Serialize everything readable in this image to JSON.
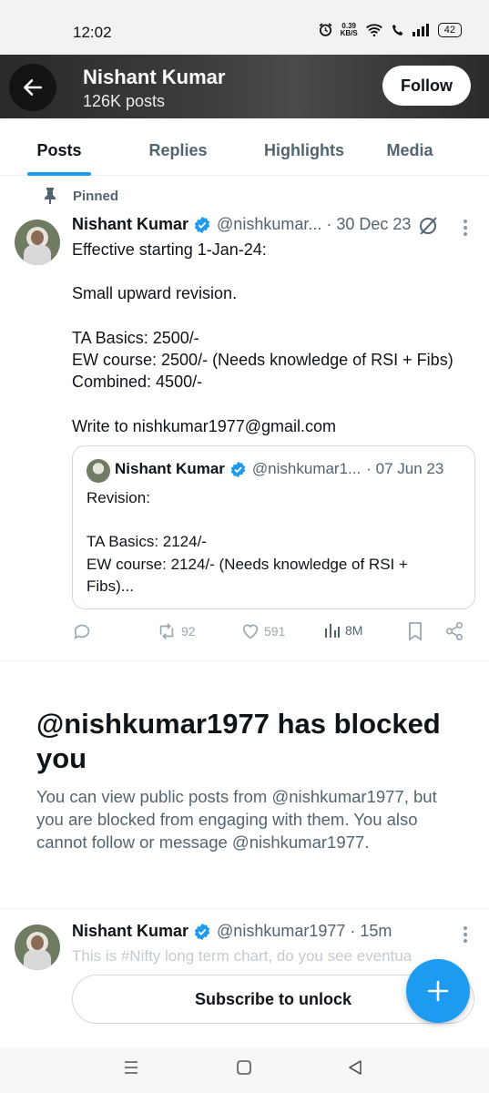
{
  "status_bar": {
    "time": "12:02",
    "net_speed_value": "0.39",
    "net_speed_unit": "KB/S",
    "battery": "42"
  },
  "header": {
    "name": "Nishant Kumar",
    "post_count": "126K posts",
    "follow_label": "Follow"
  },
  "tabs": [
    {
      "label": "Posts",
      "active": true
    },
    {
      "label": "Replies",
      "active": false
    },
    {
      "label": "Highlights",
      "active": false
    },
    {
      "label": "Media",
      "active": false
    }
  ],
  "pinned_post": {
    "pinned_label": "Pinned",
    "author_name": "Nishant Kumar",
    "handle_date": "@nishkumar... · 30 Dec 23",
    "lines": [
      "Effective starting 1-Jan-24:",
      "",
      "Small upward revision.",
      "",
      "TA Basics: 2500/-",
      "EW course: 2500/- (Needs knowledge of RSI + Fibs)",
      "Combined: 4500/-",
      "",
      "Write to nishkumar1977@gmail.com"
    ],
    "quote": {
      "author_name": "Nishant Kumar",
      "handle": "@nishkumar1...",
      "date": "· 07 Jun 23",
      "lines": [
        "Revision:",
        "",
        "TA Basics: 2124/-",
        "EW course: 2124/- (Needs knowledge of RSI +",
        "Fibs)..."
      ]
    },
    "stats": {
      "retweets": "92",
      "likes": "591",
      "views": "8M"
    }
  },
  "blocked": {
    "title": "@nishkumar1977 has blocked you",
    "message": "You can view public posts from @nishkumar1977, but you are blocked from engaging with them. You also cannot follow or message @nishkumar1977."
  },
  "second_post": {
    "author_name": "Nishant Kumar",
    "handle_time": "@nishkumar1977 · 15m",
    "teaser": "This is #Nifty long term chart, do you see eventua"
  },
  "subscribe_label": "Subscribe to unlock",
  "colors": {
    "accent": "#1d9bf0",
    "text": "#0f1419",
    "secondary": "#536471",
    "border": "#cfd9de"
  }
}
